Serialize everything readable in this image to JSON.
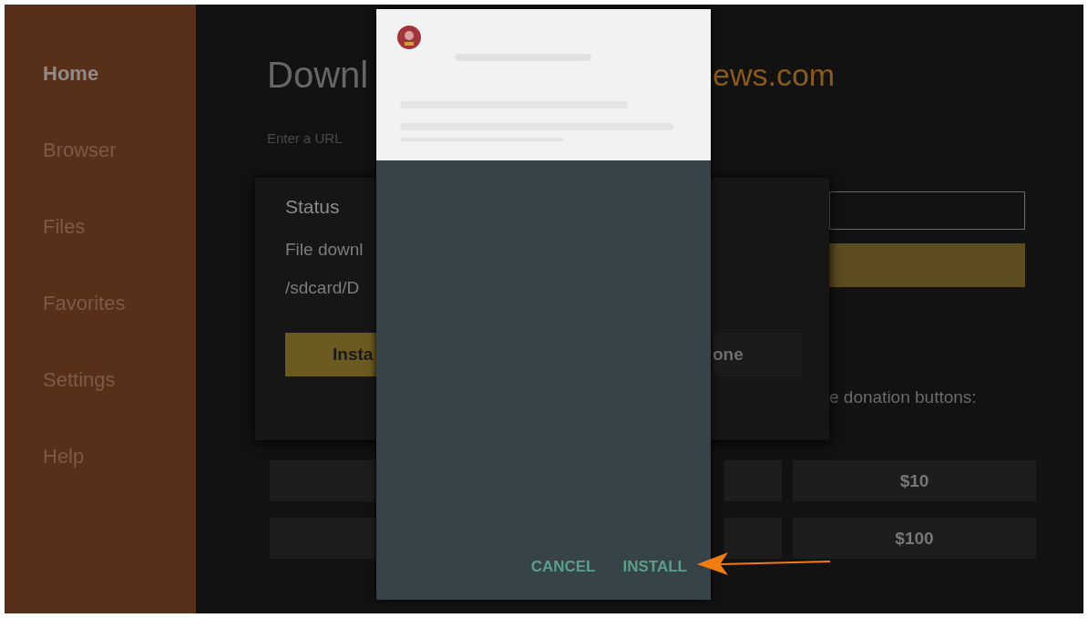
{
  "sidebar": {
    "items": [
      {
        "label": "Home",
        "selected": true
      },
      {
        "label": "Browser",
        "selected": false
      },
      {
        "label": "Files",
        "selected": false
      },
      {
        "label": "Favorites",
        "selected": false
      },
      {
        "label": "Settings",
        "selected": false
      },
      {
        "label": "Help",
        "selected": false
      }
    ]
  },
  "header": {
    "title_start": "Downl",
    "title_end": "ews.com"
  },
  "url_label": "Enter a URL",
  "donation_prompt": "e donation buttons:",
  "donation_rows": [
    {
      "amount": "$10"
    },
    {
      "amount": "$100"
    }
  ],
  "status_dialog": {
    "title": "Status",
    "message": "File downl",
    "path": "/sdcard/D",
    "buttons": [
      {
        "label": "Insta",
        "kind": "primary"
      },
      {
        "label": "one",
        "kind": "secondary"
      }
    ]
  },
  "install_dialog": {
    "buttons": [
      {
        "label": "CANCEL"
      },
      {
        "label": "INSTALL"
      }
    ]
  }
}
